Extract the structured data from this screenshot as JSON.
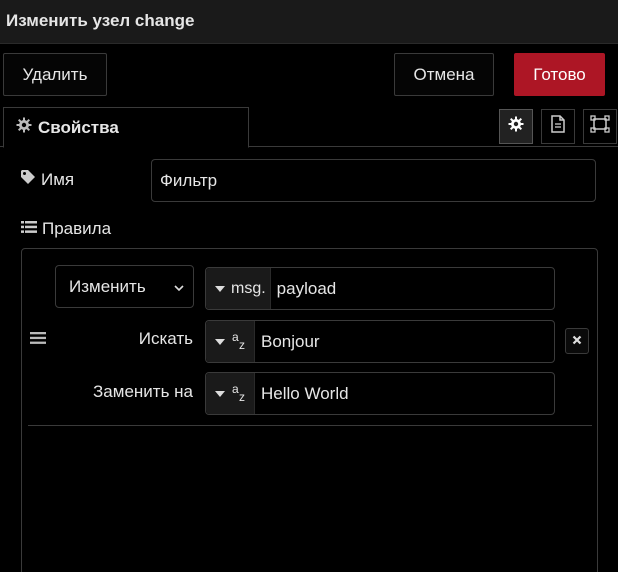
{
  "dialog": {
    "title": "Изменить узел change"
  },
  "toolbar": {
    "delete_label": "Удалить",
    "cancel_label": "Отмена",
    "done_label": "Готово"
  },
  "tabs": {
    "properties_label": "Свойства"
  },
  "form": {
    "name_label": "Имя",
    "name_value": "Фильтр",
    "rules_label": "Правила"
  },
  "rule": {
    "action": "Изменить",
    "target_prefix": "msg.",
    "target_value": "payload",
    "search_label": "Искать",
    "search_value": "Bonjour",
    "replace_label": "Заменить на",
    "replace_value": "Hello World"
  },
  "colors": {
    "accent": "#ad1625",
    "background": "#000000",
    "border": "#3a3a3a"
  }
}
